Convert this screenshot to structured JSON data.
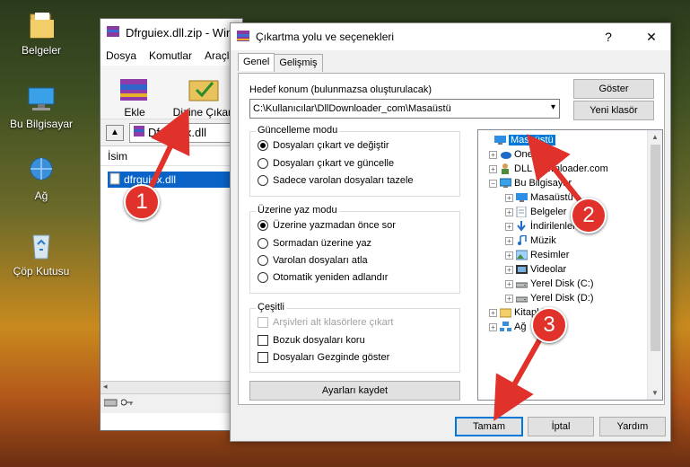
{
  "desktop": {
    "icons": [
      {
        "label": "Belgeler",
        "icon": "folder-icon"
      },
      {
        "label": "Bu Bilgisayar",
        "icon": "computer-icon"
      },
      {
        "label": "Ağ",
        "icon": "network-icon"
      },
      {
        "label": "Çöp Kutusu",
        "icon": "recycle-bin-icon"
      }
    ]
  },
  "rar": {
    "title": "Dfrguiex.dll.zip - Win",
    "menu": [
      "Dosya",
      "Komutlar",
      "Araçla"
    ],
    "tools": [
      {
        "label": "Ekle"
      },
      {
        "label": "Dizine Çıkart"
      }
    ],
    "path": "Dfrguiex.dll",
    "column": "İsim",
    "file": "dfrguiex.dll"
  },
  "dialog": {
    "title": "Çıkartma yolu ve seçenekleri",
    "help": "?",
    "close": "✕",
    "tabs": [
      "Genel",
      "Gelişmiş"
    ],
    "dest_label": "Hedef konum (bulunmazsa oluşturulacak)",
    "dest_value": "C:\\Kullanıcılar\\DllDownloader_com\\Masaüstü",
    "show_btn": "Göster",
    "new_folder_btn": "Yeni klasör",
    "update_group": {
      "title": "Güncelleme modu",
      "options": [
        {
          "label": "Dosyaları çıkart ve değiştir",
          "selected": true
        },
        {
          "label": "Dosyaları çıkart ve güncelle",
          "selected": false
        },
        {
          "label": "Sadece varolan dosyaları tazele",
          "selected": false
        }
      ]
    },
    "overwrite_group": {
      "title": "Üzerine yaz modu",
      "options": [
        {
          "label": "Üzerine yazmadan önce sor",
          "selected": true
        },
        {
          "label": "Sormadan üzerine yaz",
          "selected": false
        },
        {
          "label": "Varolan dosyaları atla",
          "selected": false
        },
        {
          "label": "Otomatik yeniden adlandır",
          "selected": false
        }
      ]
    },
    "misc_group": {
      "title": "Çeşitli",
      "options": [
        {
          "label": "Arşivleri alt klasörlere çıkart",
          "checked": false,
          "disabled": true
        },
        {
          "label": "Bozuk dosyaları koru",
          "checked": false,
          "disabled": false
        },
        {
          "label": "Dosyaları Gezginde göster",
          "checked": false,
          "disabled": false
        }
      ]
    },
    "save_btn": "Ayarları kaydet",
    "tree": [
      {
        "label": "Masaüstü",
        "icon": "desktop-icon",
        "level": 0,
        "expander": "",
        "selected": true
      },
      {
        "label": "OneDrive",
        "icon": "onedrive-icon",
        "level": 1,
        "expander": "+"
      },
      {
        "label": "DLL Downloader.com",
        "icon": "user-icon",
        "level": 1,
        "expander": "+"
      },
      {
        "label": "Bu Bilgisayar",
        "icon": "computer-icon",
        "level": 1,
        "expander": "−"
      },
      {
        "label": "Masaüstü",
        "icon": "desktop-icon",
        "level": 2,
        "expander": "+"
      },
      {
        "label": "Belgeler",
        "icon": "documents-icon",
        "level": 2,
        "expander": "+"
      },
      {
        "label": "İndirilenler",
        "icon": "downloads-icon",
        "level": 2,
        "expander": "+"
      },
      {
        "label": "Müzik",
        "icon": "music-icon",
        "level": 2,
        "expander": "+"
      },
      {
        "label": "Resimler",
        "icon": "pictures-icon",
        "level": 2,
        "expander": "+"
      },
      {
        "label": "Videolar",
        "icon": "videos-icon",
        "level": 2,
        "expander": "+"
      },
      {
        "label": "Yerel Disk (C:)",
        "icon": "drive-icon",
        "level": 2,
        "expander": "+"
      },
      {
        "label": "Yerel Disk (D:)",
        "icon": "drive-icon",
        "level": 2,
        "expander": "+"
      },
      {
        "label": "Kitaplıklar",
        "icon": "library-icon",
        "level": 1,
        "expander": "+"
      },
      {
        "label": "Ağ",
        "icon": "network-icon",
        "level": 1,
        "expander": "+"
      }
    ],
    "ok_btn": "Tamam",
    "cancel_btn": "İptal",
    "help_btn": "Yardım"
  },
  "annotations": {
    "steps": [
      "1",
      "2",
      "3"
    ],
    "color": "#e0312a"
  }
}
